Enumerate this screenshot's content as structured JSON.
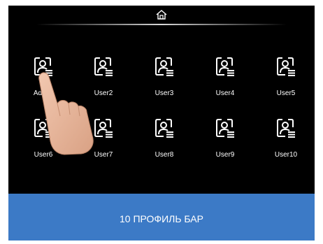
{
  "header": {
    "home_icon": "home-icon"
  },
  "users": [
    {
      "label": "Admin"
    },
    {
      "label": "User2"
    },
    {
      "label": "User3"
    },
    {
      "label": "User4"
    },
    {
      "label": "User5"
    },
    {
      "label": "User6"
    },
    {
      "label": "User7"
    },
    {
      "label": "User8"
    },
    {
      "label": "User9"
    },
    {
      "label": "User10"
    }
  ],
  "banner": {
    "text": "10 ПРОФИЛЬ БАР",
    "color": "#3c7ac6"
  },
  "colors": {
    "screen_bg": "#000000",
    "icon_stroke": "#ffffff",
    "text": "#ffffff"
  }
}
